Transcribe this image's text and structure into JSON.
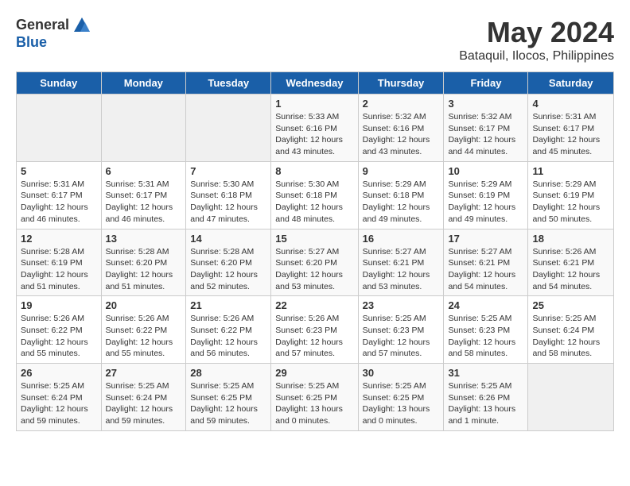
{
  "logo": {
    "general": "General",
    "blue": "Blue"
  },
  "title": {
    "month_year": "May 2024",
    "location": "Bataquil, Ilocos, Philippines"
  },
  "headers": [
    "Sunday",
    "Monday",
    "Tuesday",
    "Wednesday",
    "Thursday",
    "Friday",
    "Saturday"
  ],
  "weeks": [
    [
      {
        "day": "",
        "info": ""
      },
      {
        "day": "",
        "info": ""
      },
      {
        "day": "",
        "info": ""
      },
      {
        "day": "1",
        "info": "Sunrise: 5:33 AM\nSunset: 6:16 PM\nDaylight: 12 hours\nand 43 minutes."
      },
      {
        "day": "2",
        "info": "Sunrise: 5:32 AM\nSunset: 6:16 PM\nDaylight: 12 hours\nand 43 minutes."
      },
      {
        "day": "3",
        "info": "Sunrise: 5:32 AM\nSunset: 6:17 PM\nDaylight: 12 hours\nand 44 minutes."
      },
      {
        "day": "4",
        "info": "Sunrise: 5:31 AM\nSunset: 6:17 PM\nDaylight: 12 hours\nand 45 minutes."
      }
    ],
    [
      {
        "day": "5",
        "info": "Sunrise: 5:31 AM\nSunset: 6:17 PM\nDaylight: 12 hours\nand 46 minutes."
      },
      {
        "day": "6",
        "info": "Sunrise: 5:31 AM\nSunset: 6:17 PM\nDaylight: 12 hours\nand 46 minutes."
      },
      {
        "day": "7",
        "info": "Sunrise: 5:30 AM\nSunset: 6:18 PM\nDaylight: 12 hours\nand 47 minutes."
      },
      {
        "day": "8",
        "info": "Sunrise: 5:30 AM\nSunset: 6:18 PM\nDaylight: 12 hours\nand 48 minutes."
      },
      {
        "day": "9",
        "info": "Sunrise: 5:29 AM\nSunset: 6:18 PM\nDaylight: 12 hours\nand 49 minutes."
      },
      {
        "day": "10",
        "info": "Sunrise: 5:29 AM\nSunset: 6:19 PM\nDaylight: 12 hours\nand 49 minutes."
      },
      {
        "day": "11",
        "info": "Sunrise: 5:29 AM\nSunset: 6:19 PM\nDaylight: 12 hours\nand 50 minutes."
      }
    ],
    [
      {
        "day": "12",
        "info": "Sunrise: 5:28 AM\nSunset: 6:19 PM\nDaylight: 12 hours\nand 51 minutes."
      },
      {
        "day": "13",
        "info": "Sunrise: 5:28 AM\nSunset: 6:20 PM\nDaylight: 12 hours\nand 51 minutes."
      },
      {
        "day": "14",
        "info": "Sunrise: 5:28 AM\nSunset: 6:20 PM\nDaylight: 12 hours\nand 52 minutes."
      },
      {
        "day": "15",
        "info": "Sunrise: 5:27 AM\nSunset: 6:20 PM\nDaylight: 12 hours\nand 53 minutes."
      },
      {
        "day": "16",
        "info": "Sunrise: 5:27 AM\nSunset: 6:21 PM\nDaylight: 12 hours\nand 53 minutes."
      },
      {
        "day": "17",
        "info": "Sunrise: 5:27 AM\nSunset: 6:21 PM\nDaylight: 12 hours\nand 54 minutes."
      },
      {
        "day": "18",
        "info": "Sunrise: 5:26 AM\nSunset: 6:21 PM\nDaylight: 12 hours\nand 54 minutes."
      }
    ],
    [
      {
        "day": "19",
        "info": "Sunrise: 5:26 AM\nSunset: 6:22 PM\nDaylight: 12 hours\nand 55 minutes."
      },
      {
        "day": "20",
        "info": "Sunrise: 5:26 AM\nSunset: 6:22 PM\nDaylight: 12 hours\nand 55 minutes."
      },
      {
        "day": "21",
        "info": "Sunrise: 5:26 AM\nSunset: 6:22 PM\nDaylight: 12 hours\nand 56 minutes."
      },
      {
        "day": "22",
        "info": "Sunrise: 5:26 AM\nSunset: 6:23 PM\nDaylight: 12 hours\nand 57 minutes."
      },
      {
        "day": "23",
        "info": "Sunrise: 5:25 AM\nSunset: 6:23 PM\nDaylight: 12 hours\nand 57 minutes."
      },
      {
        "day": "24",
        "info": "Sunrise: 5:25 AM\nSunset: 6:23 PM\nDaylight: 12 hours\nand 58 minutes."
      },
      {
        "day": "25",
        "info": "Sunrise: 5:25 AM\nSunset: 6:24 PM\nDaylight: 12 hours\nand 58 minutes."
      }
    ],
    [
      {
        "day": "26",
        "info": "Sunrise: 5:25 AM\nSunset: 6:24 PM\nDaylight: 12 hours\nand 59 minutes."
      },
      {
        "day": "27",
        "info": "Sunrise: 5:25 AM\nSunset: 6:24 PM\nDaylight: 12 hours\nand 59 minutes."
      },
      {
        "day": "28",
        "info": "Sunrise: 5:25 AM\nSunset: 6:25 PM\nDaylight: 12 hours\nand 59 minutes."
      },
      {
        "day": "29",
        "info": "Sunrise: 5:25 AM\nSunset: 6:25 PM\nDaylight: 13 hours\nand 0 minutes."
      },
      {
        "day": "30",
        "info": "Sunrise: 5:25 AM\nSunset: 6:25 PM\nDaylight: 13 hours\nand 0 minutes."
      },
      {
        "day": "31",
        "info": "Sunrise: 5:25 AM\nSunset: 6:26 PM\nDaylight: 13 hours\nand 1 minute."
      },
      {
        "day": "",
        "info": ""
      }
    ]
  ]
}
